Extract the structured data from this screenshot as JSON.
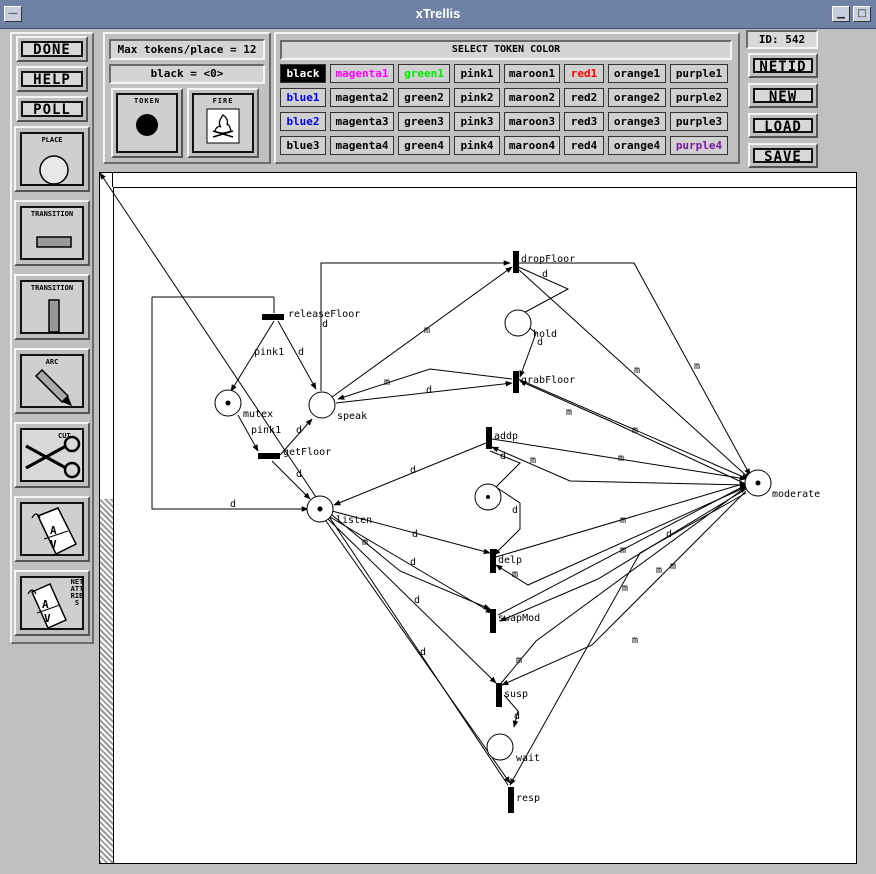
{
  "window": {
    "title": "xTrellis"
  },
  "tools": [
    {
      "id": "done",
      "label": "DONE"
    },
    {
      "id": "help",
      "label": "HELP"
    },
    {
      "id": "poll",
      "label": "POLL"
    }
  ],
  "palette": {
    "place_label": "PLACE",
    "transition_h_label": "TRANSITION",
    "transition_v_label": "TRANSITION",
    "arc_label": "ARC",
    "cut_label": "CUT",
    "netattr_label": "NET ATTRIBS"
  },
  "tokens": {
    "max_label": "Max tokens/place = 12",
    "current": "black = <0>",
    "token_button": "TOKEN",
    "fire_button": "FIRE"
  },
  "colors": {
    "header": "SELECT TOKEN COLOR",
    "selected": "black",
    "rows": [
      [
        "black",
        "magenta1",
        "green1",
        "pink1",
        "maroon1",
        "red1",
        "orange1",
        "purple1"
      ],
      [
        "blue1",
        "magenta2",
        "green2",
        "pink2",
        "maroon2",
        "red2",
        "orange2",
        "purple2"
      ],
      [
        "blue2",
        "magenta3",
        "green3",
        "pink3",
        "maroon3",
        "red3",
        "orange3",
        "purple3"
      ],
      [
        "blue3",
        "magenta4",
        "green4",
        "pink4",
        "maroon4",
        "red4",
        "orange4",
        "purple4"
      ]
    ],
    "text_colors": {
      "magenta1": "#ff00ff",
      "green1": "#00ee00",
      "red1": "#ff0000",
      "blue1": "#0000ee",
      "blue2": "#0000ee",
      "purple4": "#7a1aa0"
    }
  },
  "right": {
    "id_label": "ID: 542",
    "buttons": [
      "NETID",
      "NEW",
      "LOAD",
      "SAVE"
    ]
  },
  "net": {
    "places": [
      {
        "name": "mutex",
        "label": "mutex",
        "token": true
      },
      {
        "name": "speak",
        "label": "speak",
        "token": false
      },
      {
        "name": "hold",
        "label": "hold",
        "token": false
      },
      {
        "name": "listen",
        "label": "listen",
        "token": true
      },
      {
        "name": "moderate",
        "label": "moderate",
        "token": true
      },
      {
        "name": "inner",
        "label": "",
        "token": true
      },
      {
        "name": "wait",
        "label": "wait",
        "token": false
      }
    ],
    "transitions": [
      {
        "name": "releaseFloor",
        "label": "releaseFloor"
      },
      {
        "name": "getFloor",
        "label": "getFloor"
      },
      {
        "name": "dropFloor",
        "label": "dropFloor"
      },
      {
        "name": "grabFloor",
        "label": "grabFloor"
      },
      {
        "name": "addp",
        "label": "addp"
      },
      {
        "name": "delp",
        "label": "delp"
      },
      {
        "name": "swapMod",
        "label": "swapMod"
      },
      {
        "name": "susp",
        "label": "susp"
      },
      {
        "name": "resp",
        "label": "resp"
      }
    ],
    "arc_labels": {
      "pink1_a": "pink1",
      "pink1_b": "pink1",
      "d": "d",
      "m": "m"
    }
  }
}
